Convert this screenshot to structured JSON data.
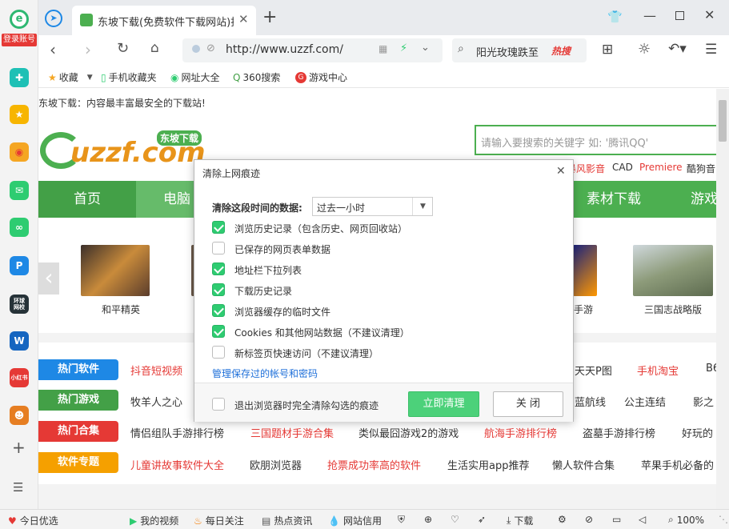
{
  "sidebar": {
    "login_label": "登录账号",
    "toutiao": "环球\n网校",
    "hot": "小红书"
  },
  "tabs": {
    "active_title": "东坡下载(免费软件下载网站)打",
    "new_tab": "+"
  },
  "address": {
    "url": "http://www.uzzf.com/",
    "search_text": "阳光玫瑰跌至",
    "hot_label": "热搜"
  },
  "bookmarks": [
    "收藏",
    "手机收藏夹",
    "网址大全",
    "360搜索",
    "游戏中心"
  ],
  "page": {
    "tagline": "东坡下载：内容最丰富最安全的下载站!",
    "logo_text": "uzzf.com",
    "logo_badge": "东坡下载",
    "search_placeholder": "请输入要搜索的关键字 如: '腾讯QQ'",
    "hot_links": [
      "暴风影音",
      "CAD",
      "Premiere",
      "酷狗音"
    ],
    "nav": [
      "首页",
      "电脑软",
      "素材下载",
      "游戏"
    ],
    "games": [
      {
        "name": "和平精英"
      },
      {
        "name": "手游"
      },
      {
        "name": "三国志战略版"
      }
    ],
    "rows": [
      {
        "cat": "热门软件",
        "color": "#1e88e5",
        "items_left": [
          "抖音短视频"
        ],
        "items_right": [
          "天天P图",
          "手机淘宝",
          "B6"
        ]
      },
      {
        "cat": "热门游戏",
        "color": "#43a047",
        "items_left": [
          "牧羊人之心"
        ],
        "items_right": [
          "蓝航线",
          "公主连结",
          "影之"
        ]
      },
      {
        "cat": "热门合集",
        "color": "#e53935",
        "items": [
          "情侣组队手游排行榜",
          "三国题材手游合集",
          "类似最囧游戏2的游戏",
          "航海手游排行榜",
          "盗墓手游排行榜",
          "好玩的"
        ]
      },
      {
        "cat": "软件专题",
        "color": "#f5a000",
        "items": [
          "儿童讲故事软件大全",
          "欧朋浏览器",
          "抢票成功率高的软件",
          "生活实用app推荐",
          "懒人软件合集",
          "苹果手机必备的"
        ]
      }
    ]
  },
  "dialog": {
    "title": "清除上网痕迹",
    "range_label": "清除这段时间的数据:",
    "range_value": "过去一小时",
    "options": [
      {
        "label": "浏览历史记录（包含历史、网页回收站）",
        "checked": true
      },
      {
        "label": "已保存的网页表单数据",
        "checked": false
      },
      {
        "label": "地址栏下拉列表",
        "checked": true
      },
      {
        "label": "下载历史记录",
        "checked": true
      },
      {
        "label": "浏览器缓存的临时文件",
        "checked": true
      },
      {
        "label": "Cookies 和其他网站数据（不建议清理）",
        "checked": true
      },
      {
        "label": "新标签页快速访问（不建议清理）",
        "checked": false
      }
    ],
    "manage_link": "管理保存过的帐号和密码",
    "exit_option": "退出浏览器时完全清除勾选的痕迹",
    "clear_button": "立即清理",
    "close_button": "关 闭"
  },
  "status": [
    "今日优选",
    "我的视频",
    "每日关注",
    "热点资讯",
    "网站信用",
    "下载",
    "100%"
  ],
  "colors": {
    "accent_green": "#4caf50",
    "check_green": "#2ecc71",
    "red": "#e53935"
  }
}
